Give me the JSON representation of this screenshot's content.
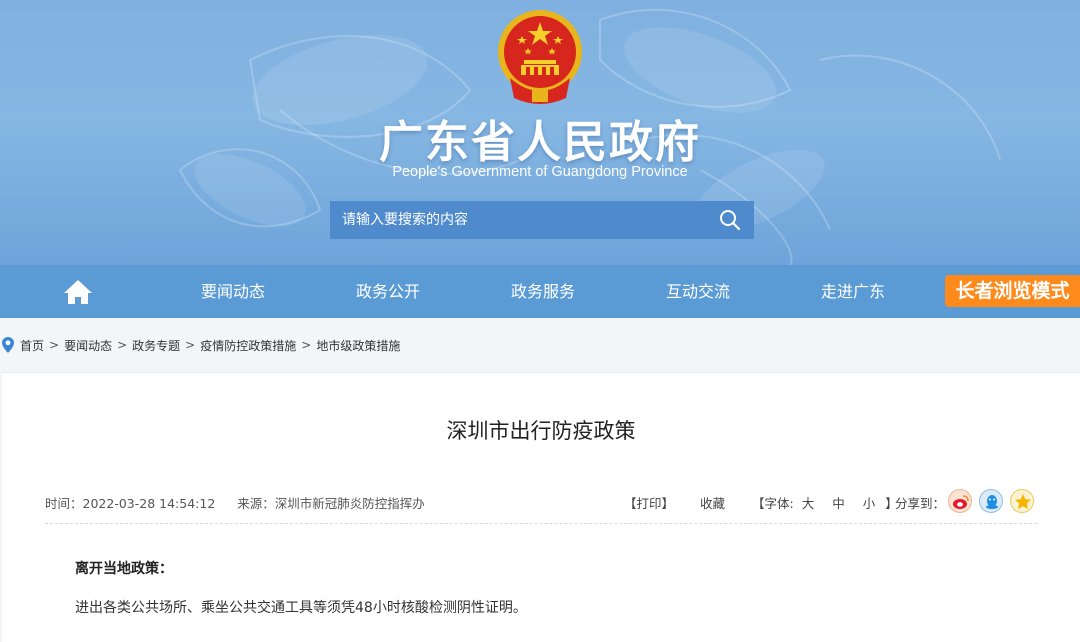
{
  "header": {
    "title": "广东省人民政府",
    "subtitle": "People's Government of Guangdong Province",
    "search_placeholder": "请输入要搜索的内容"
  },
  "nav": {
    "items": [
      "要闻动态",
      "政务公开",
      "政务服务",
      "互动交流",
      "走进广东"
    ],
    "elder_mode": "长者浏览模式"
  },
  "breadcrumb": [
    "首页",
    "要闻动态",
    "政务专题",
    "疫情防控政策措施",
    "地市级政策措施"
  ],
  "article": {
    "title": "深圳市出行防疫政策",
    "time_label": "时间：",
    "time": "2022-03-28 14:54:12",
    "source_label": "来源：",
    "source": "深圳市新冠肺炎防控指挥办",
    "print": "【打印】",
    "favorite": "收藏",
    "font_label": "【字体:",
    "font_sizes": [
      "大",
      "中",
      "小"
    ],
    "font_close": "】",
    "share_label": "分享到：",
    "share_icons": [
      "weibo-icon",
      "qq-icon",
      "qzone-icon"
    ],
    "section_heading": "离开当地政策：",
    "paragraph": "进出各类公共场所、乘坐公共交通工具等须凭48小时核酸检测阴性证明。"
  },
  "colors": {
    "nav_bg": "#5b9bd5",
    "elder_btn": "#ff8a1c",
    "banner": "#7fb0df",
    "search_bg": "#4f8bcc"
  }
}
